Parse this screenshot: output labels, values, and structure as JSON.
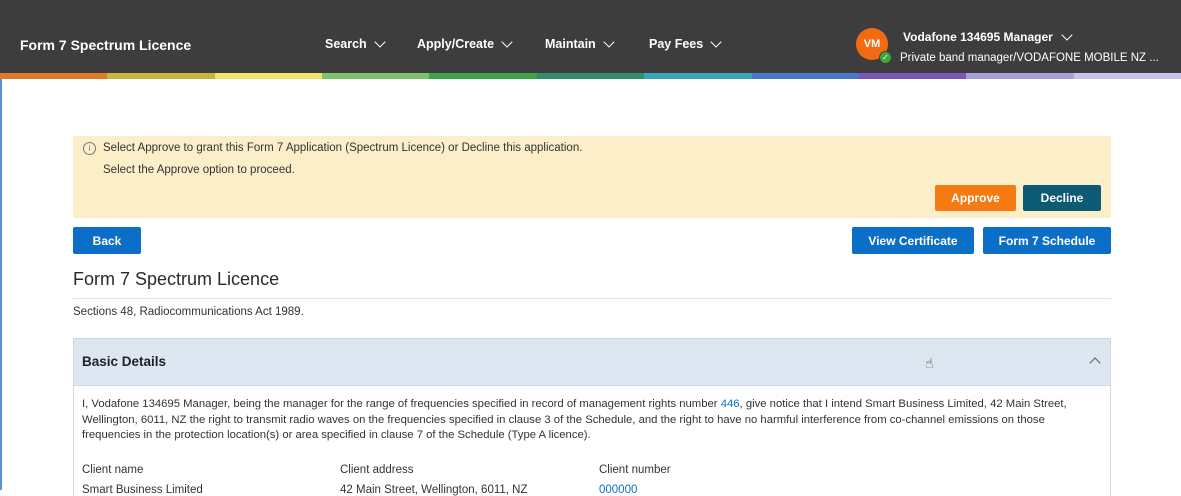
{
  "header": {
    "title": "Form 7 Spectrum Licence",
    "nav": [
      {
        "label": "Search"
      },
      {
        "label": "Apply/Create"
      },
      {
        "label": "Maintain"
      },
      {
        "label": "Pay Fees"
      }
    ],
    "user": {
      "initials": "VM",
      "name": "Vodafone 134695 Manager",
      "role": "Private band manager/VODAFONE MOBILE NZ ..."
    },
    "stripe_colors": [
      "#e07a2c",
      "#c9b440",
      "#f0e46a",
      "#7cc36a",
      "#3fa34a",
      "#2e8f6a",
      "#3aa4b8",
      "#4a78c8",
      "#7a58b8",
      "#a8a0d8",
      "#c7c2ea"
    ]
  },
  "notice": {
    "line1": "Select Approve to grant this Form 7 Application (Spectrum Licence) or Decline this application.",
    "line2": "Select the Approve option to proceed.",
    "approve_label": "Approve",
    "decline_label": "Decline"
  },
  "actions": {
    "back_label": "Back",
    "view_certificate_label": "View Certificate",
    "form7_schedule_label": "Form 7 Schedule"
  },
  "page": {
    "heading": "Form 7 Spectrum Licence",
    "sections_text": "Sections 48, Radiocommunications Act 1989."
  },
  "basic_details": {
    "title": "Basic Details",
    "para_pre": "I, Vodafone 134695 Manager, being the manager for the range of frequencies specified in record of management rights number ",
    "rights_number": "446",
    "para_post": ", give notice that I intend Smart Business Limited, 42 Main Street, Wellington, 6011, NZ the right to transmit radio waves on the frequencies specified in clause 3 of the Schedule, and the right to have no harmful interference from co-channel emissions on those frequencies in the protection location(s) or area specified in clause 7 of the Schedule (Type A licence).",
    "fields": [
      {
        "label": "Client name",
        "value": "Smart Business Limited"
      },
      {
        "label": "Client address",
        "value": "42 Main Street, Wellington, 6011, NZ"
      },
      {
        "label": "Client number",
        "value": "000000"
      }
    ]
  }
}
